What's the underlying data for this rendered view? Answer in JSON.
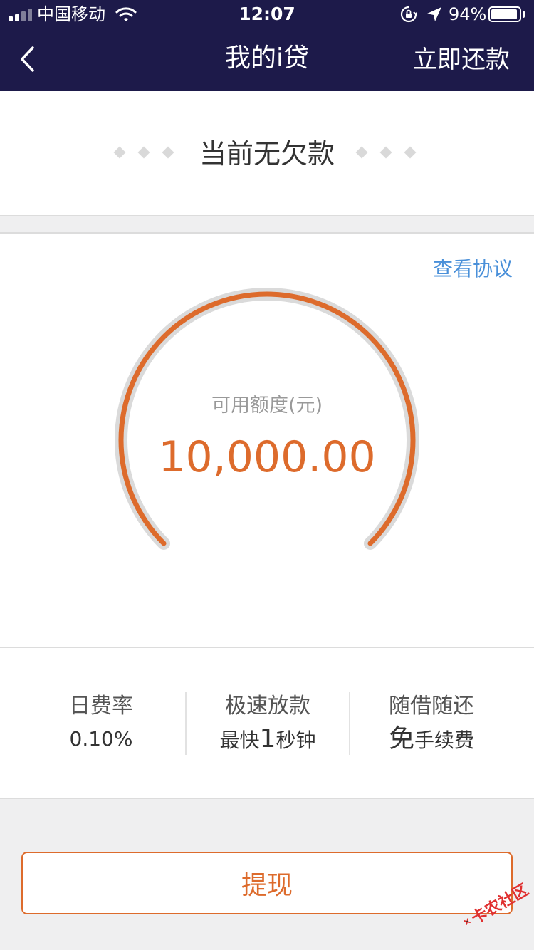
{
  "status_bar": {
    "carrier": "中国移动",
    "time": "12:07",
    "battery_pct": "94%",
    "battery_level": 0.94
  },
  "nav": {
    "title": "我的i贷",
    "action_label": "立即还款"
  },
  "debt": {
    "status_text": "当前无欠款"
  },
  "credit": {
    "agreement_link": "查看协议",
    "label": "可用额度(元)",
    "amount": "10,000.00",
    "gauge_level": 1.0
  },
  "features": [
    {
      "title": "日费率",
      "value": "0.10%"
    },
    {
      "title": "极速放款",
      "value_prefix": "最快",
      "value_emphasis": "1",
      "value_suffix": "秒钟"
    },
    {
      "title": "随借随还",
      "value_emphasis": "免",
      "value_suffix": "手续费"
    }
  ],
  "withdraw_label": "提现",
  "watermark_text": "卡农社区",
  "colors": {
    "nav_bg": "#1d1a4a",
    "accent": "#dd6b2c",
    "link": "#4a90d9",
    "gauge_track": "#dadada"
  }
}
